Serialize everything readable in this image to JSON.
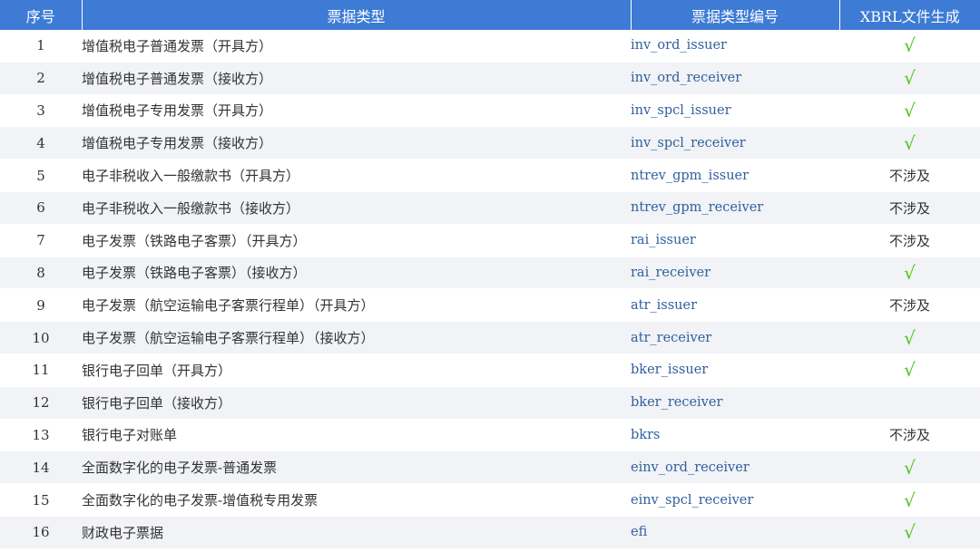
{
  "columns": [
    "序号",
    "票据类型",
    "票据类型编号",
    "XBRL文件生成"
  ],
  "rows": [
    {
      "no": "1",
      "type": "增值税电子普通发票（开具方）",
      "code": "inv_ord_issuer",
      "xbrl": "√"
    },
    {
      "no": "2",
      "type": "增值税电子普通发票（接收方）",
      "code": "inv_ord_receiver",
      "xbrl": "√"
    },
    {
      "no": "3",
      "type": "增值税电子专用发票（开具方）",
      "code": "inv_spcl_issuer",
      "xbrl": "√"
    },
    {
      "no": "4",
      "type": "增值税电子专用发票（接收方）",
      "code": "inv_spcl_receiver",
      "xbrl": "√"
    },
    {
      "no": "5",
      "type": "电子非税收入一般缴款书（开具方）",
      "code": "ntrev_gpm_issuer",
      "xbrl": "不涉及"
    },
    {
      "no": "6",
      "type": "电子非税收入一般缴款书（接收方）",
      "code": "ntrev_gpm_receiver",
      "xbrl": "不涉及"
    },
    {
      "no": "7",
      "type": "电子发票（铁路电子客票）（开具方）",
      "code": "rai_issuer",
      "xbrl": "不涉及"
    },
    {
      "no": "8",
      "type": "电子发票（铁路电子客票）（接收方）",
      "code": "rai_receiver",
      "xbrl": "√"
    },
    {
      "no": "9",
      "type": "电子发票（航空运输电子客票行程单）（开具方）",
      "code": "atr_issuer",
      "xbrl": "不涉及"
    },
    {
      "no": "10",
      "type": "电子发票（航空运输电子客票行程单）（接收方）",
      "code": "atr_receiver",
      "xbrl": "√"
    },
    {
      "no": "11",
      "type": "银行电子回单（开具方）",
      "code": "bker_issuer",
      "xbrl": "√"
    },
    {
      "no": "12",
      "type": "银行电子回单（接收方）",
      "code": "bker_receiver",
      "xbrl": ""
    },
    {
      "no": "13",
      "type": "银行电子对账单",
      "code": "bkrs",
      "xbrl": "不涉及"
    },
    {
      "no": "14",
      "type": "全面数字化的电子发票-普通发票",
      "code": "einv_ord_receiver",
      "xbrl": "√"
    },
    {
      "no": "15",
      "type": "全面数字化的电子发票-增值税专用发票",
      "code": "einv_spcl_receiver",
      "xbrl": "√"
    },
    {
      "no": "16",
      "type": "财政电子票据",
      "code": "efi",
      "xbrl": "√"
    }
  ],
  "colors": {
    "header_bg": "#3d7bd5",
    "check": "#52c41a",
    "code_text": "#2f5f9e",
    "stripe": "#f1f3f6"
  }
}
